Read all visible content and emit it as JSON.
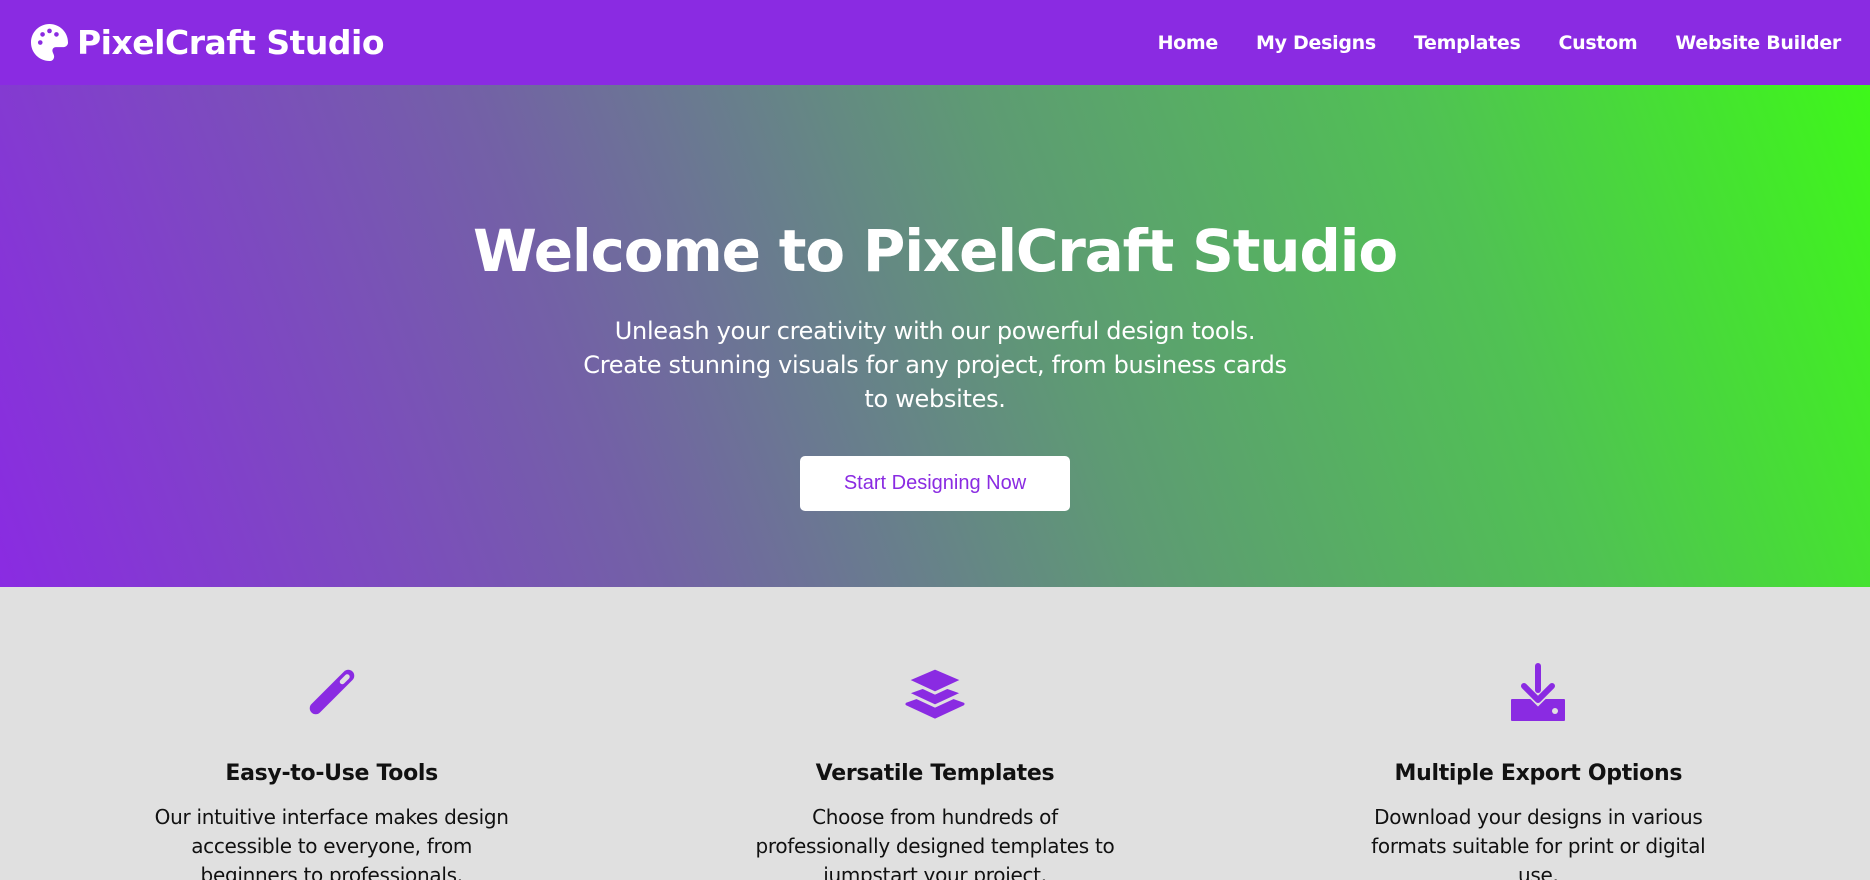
{
  "header": {
    "brand": "PixelCraft Studio",
    "brand_icon": "palette-icon",
    "nav": [
      {
        "label": "Home"
      },
      {
        "label": "My Designs"
      },
      {
        "label": "Templates"
      },
      {
        "label": "Custom"
      },
      {
        "label": "Website Builder"
      }
    ]
  },
  "hero": {
    "title": "Welcome to PixelCraft Studio",
    "subtitle": "Unleash your creativity with our powerful design tools. Create stunning visuals for any project, from business cards to websites.",
    "cta_label": "Start Designing Now"
  },
  "features": [
    {
      "icon": "magic-wand-icon",
      "title": "Easy-to-Use Tools",
      "description": "Our intuitive interface makes design accessible to everyone, from beginners to professionals."
    },
    {
      "icon": "layers-icon",
      "title": "Versatile Templates",
      "description": "Choose from hundreds of professionally designed templates to jumpstart your project."
    },
    {
      "icon": "download-icon",
      "title": "Multiple Export Options",
      "description": "Download your designs in various formats suitable for print or digital use."
    }
  ],
  "colors": {
    "brand_purple": "#8a2be2",
    "hero_gradient_start": "#8a2be2",
    "hero_gradient_end": "#3ef81a",
    "features_background": "#e0e0e0"
  }
}
